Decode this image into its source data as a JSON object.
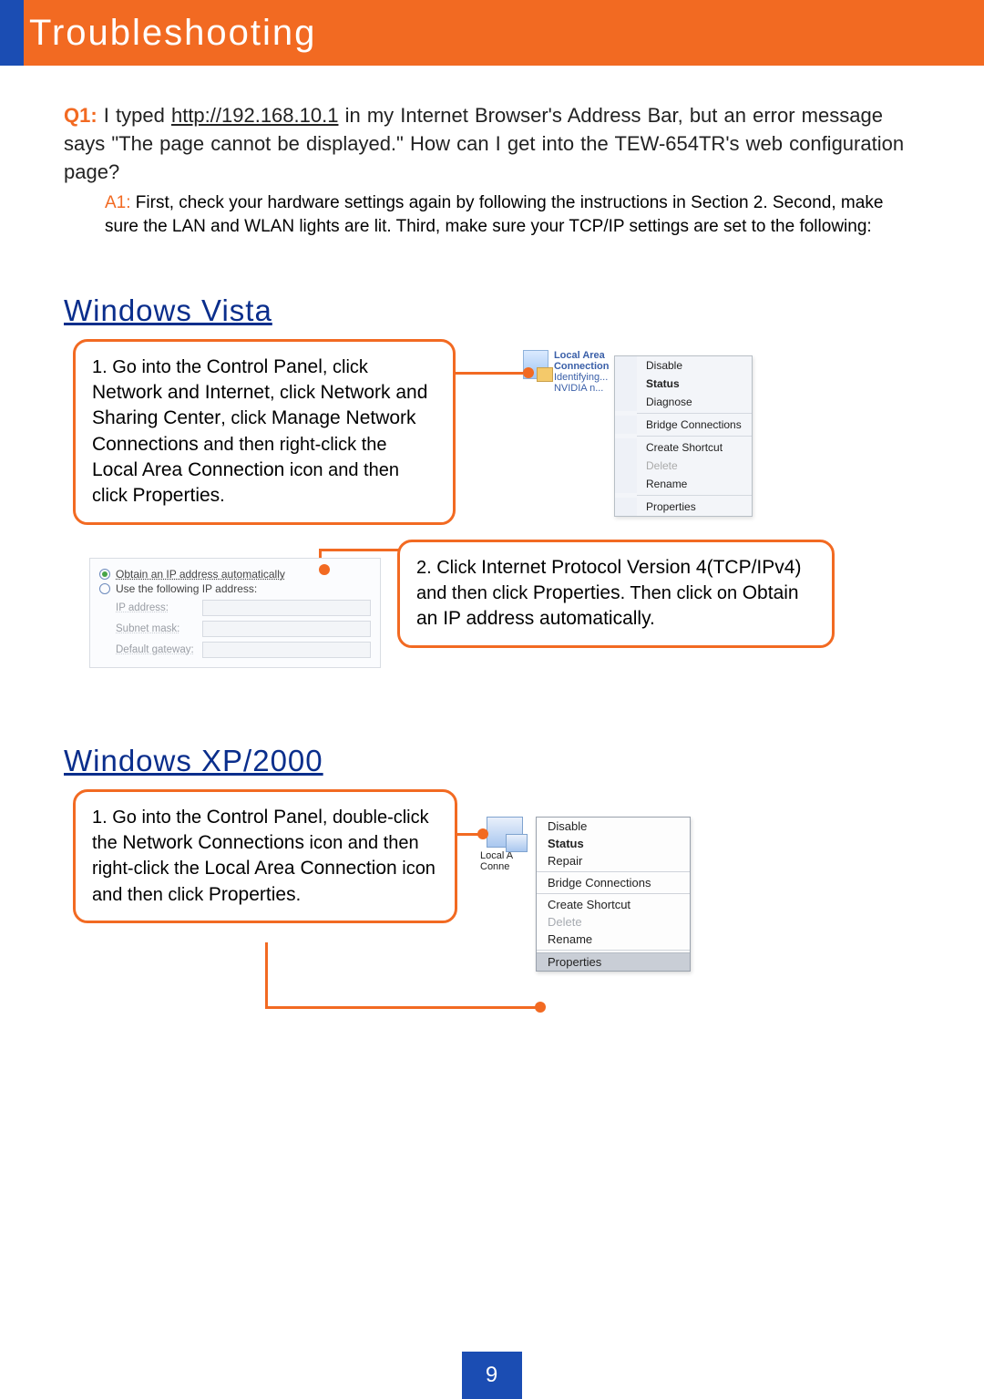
{
  "header": {
    "title": "Troubleshooting"
  },
  "q1": {
    "label": "Q1:",
    "text_before_url": " I typed ",
    "url": "http://192.168.10.1",
    "text_after_url": "  in my Internet Browser's Address Bar, but an error message says \"The page cannot be displayed.\" How can I get into the TEW-654TR's web configuration page?"
  },
  "a1": {
    "label": "A1:",
    "text": " First, check your hardware settings again by following the instructions in Section 2.  Second, make sure the LAN and WLAN lights are lit.  Third, make sure your TCP/IP settings are set to the following:"
  },
  "vista": {
    "heading": "Windows Vista",
    "step1": {
      "prefix": "1. Go into the ",
      "s1": "Control Panel",
      "t1": ", click ",
      "s2": "Network and Internet",
      "t2": ", click ",
      "s3": "Network and Sharing Center",
      "t3": ", click ",
      "s4": "Manage Network Connections",
      "t4": " and then right-click the ",
      "s5": "Local Area Connection",
      "t5": " icon and then click ",
      "s6": "Properties",
      "t6": "."
    },
    "icon_caption_line1": "Local Area Connection",
    "icon_caption_line2": "Identifying...",
    "icon_caption_line3": "NVIDIA n...",
    "menu": [
      "Disable",
      "Status",
      "Diagnose",
      "|",
      "Bridge Connections",
      "|",
      "Create Shortcut",
      "Delete",
      "Rename",
      "|",
      "Properties"
    ],
    "ip_panel": {
      "radio_on": "Obtain an IP address automatically",
      "radio_off": "Use the following IP address:",
      "fields": [
        "IP address:",
        "Subnet mask:",
        "Default gateway:"
      ]
    },
    "step2": {
      "prefix": "2. Click ",
      "s1": "Internet Protocol Version 4(TCP/IPv4)",
      "t1": " and then click ",
      "s2": "Properties",
      "t2": ". Then click on ",
      "s3": "Obtain an IP address automatically.",
      "t3": ""
    }
  },
  "xp": {
    "heading": "Windows XP/2000",
    "step1": {
      "prefix": "1. Go into the ",
      "s1": "Control Panel",
      "t1": ", double-click the ",
      "s2": "Network Connections",
      "t2": " icon and then right-click the ",
      "s3": "Local Area Connection",
      "t3": " icon and then click ",
      "s4": "Properties",
      "t4": "."
    },
    "icon_caption_line1": "Local A",
    "icon_caption_line2": "Conne",
    "menu": [
      "Disable",
      "Status",
      "Repair",
      "|",
      "Bridge Connections",
      "|",
      "Create Shortcut",
      "Delete",
      "Rename",
      "|",
      "Properties"
    ]
  },
  "page_number": "9"
}
